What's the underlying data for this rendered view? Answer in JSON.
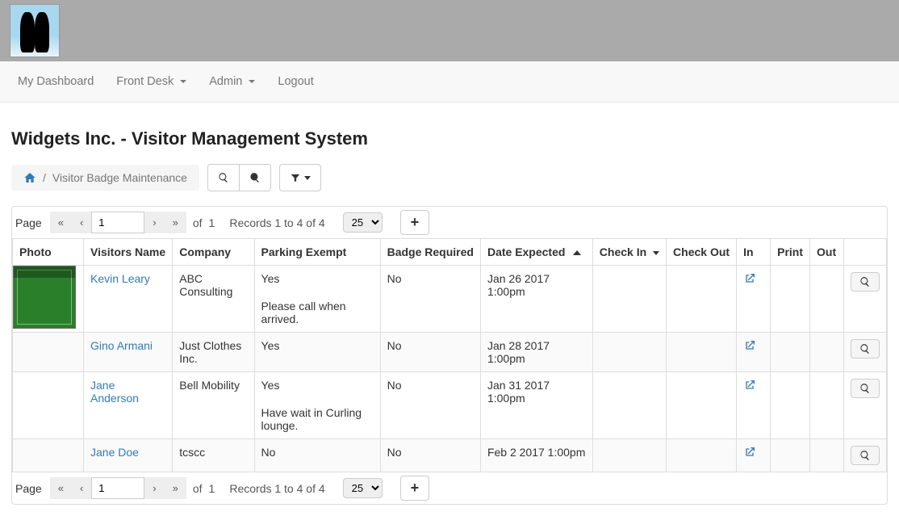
{
  "nav": {
    "dashboard": "My Dashboard",
    "frontdesk": "Front Desk",
    "admin": "Admin",
    "logout": "Logout"
  },
  "page_title": "Widgets Inc. - Visitor Management System",
  "breadcrumb": {
    "current": "Visitor Badge Maintenance",
    "separator": "/"
  },
  "pager": {
    "page_label": "Page",
    "page_value": "1",
    "total_pages_prefix": "of",
    "total_pages": "1",
    "records_info": "Records 1 to 4 of 4",
    "page_size": "25"
  },
  "columns": {
    "photo": "Photo",
    "visitors_name": "Visitors Name",
    "company": "Company",
    "parking_exempt": "Parking Exempt",
    "badge_required": "Badge Required",
    "date_expected": "Date Expected",
    "check_in": "Check In",
    "check_out": "Check Out",
    "in": "In",
    "print": "Print",
    "out": "Out"
  },
  "rows": [
    {
      "has_photo": true,
      "name": "Kevin Leary",
      "company": "ABC Consulting",
      "parking_exempt": "Yes",
      "parking_note": "Please call when arrived.",
      "badge_required": "No",
      "date_expected": "Jan 26 2017 1:00pm"
    },
    {
      "has_photo": false,
      "name": "Gino Armani",
      "company": "Just Clothes Inc.",
      "parking_exempt": "Yes",
      "parking_note": "",
      "badge_required": "No",
      "date_expected": "Jan 28 2017 1:00pm"
    },
    {
      "has_photo": false,
      "name": "Jane Anderson",
      "company": "Bell Mobility",
      "parking_exempt": "Yes",
      "parking_note": "Have wait in Curling lounge.",
      "badge_required": "No",
      "date_expected": "Jan 31 2017 1:00pm"
    },
    {
      "has_photo": false,
      "name": "Jane Doe",
      "company": "tcscc",
      "parking_exempt": "No",
      "parking_note": "",
      "badge_required": "No",
      "date_expected": "Feb 2 2017 1:00pm"
    }
  ]
}
